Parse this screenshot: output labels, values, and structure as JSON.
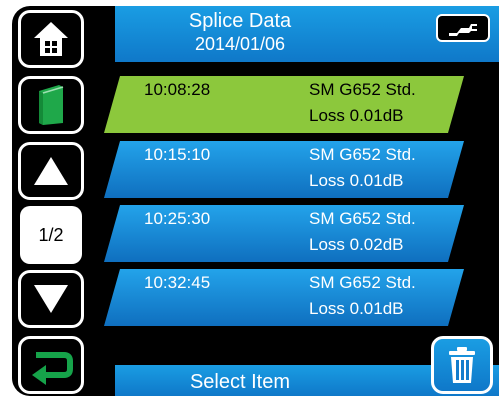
{
  "header": {
    "title": "Splice Data",
    "date": "2014/01/06"
  },
  "footer": {
    "label": "Select Item"
  },
  "pagination": {
    "current_page": "1/2"
  },
  "entries": [
    {
      "time": "10:08:28",
      "fiber": "SM G652 Std.",
      "loss": "Loss 0.01dB",
      "selected": true
    },
    {
      "time": "10:15:10",
      "fiber": "SM G652 Std.",
      "loss": "Loss 0.01dB",
      "selected": false
    },
    {
      "time": "10:25:30",
      "fiber": "SM G652 Std.",
      "loss": "Loss 0.02dB",
      "selected": false
    },
    {
      "time": "10:32:45",
      "fiber": "SM G652 Std.",
      "loss": "Loss 0.01dB",
      "selected": false
    }
  ],
  "icons": {
    "home": "home-icon",
    "book": "book-icon",
    "up": "up-arrow-icon",
    "down": "down-arrow-icon",
    "back": "return-arrow-icon",
    "plug": "plug-icon",
    "trash": "trash-icon"
  },
  "colors": {
    "selected_row": "#8cc83c",
    "row": "#1591dc",
    "header": "#1590d8",
    "back_arrow": "#16a34a",
    "book": "#1fa84a"
  }
}
